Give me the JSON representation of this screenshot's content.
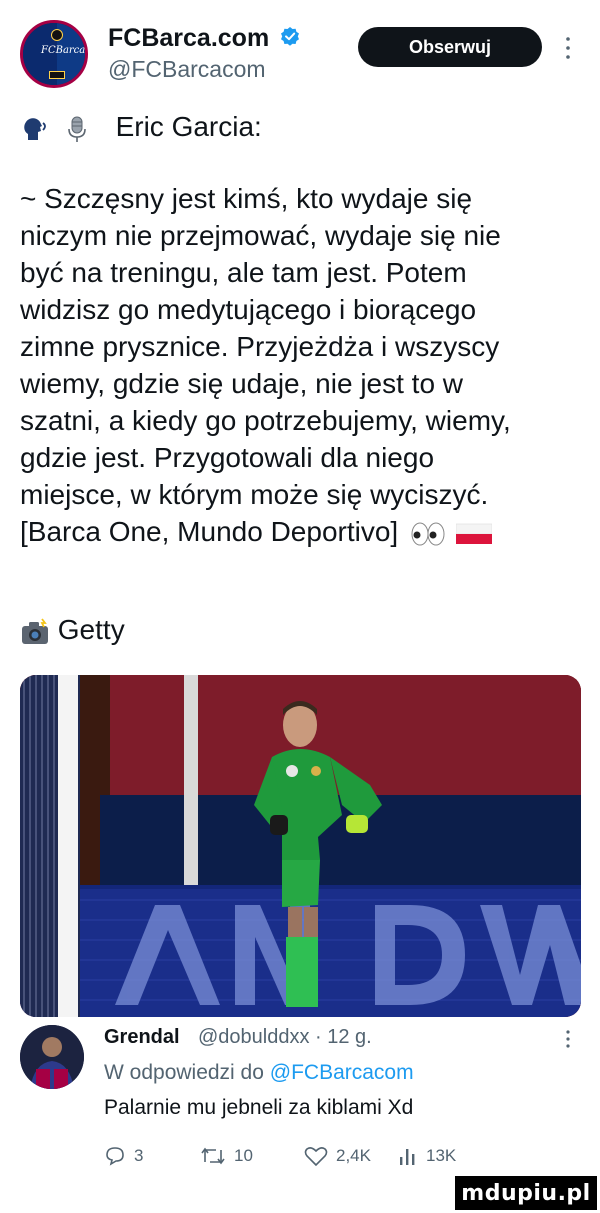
{
  "author": {
    "display_name": "FCBarca.com",
    "handle": "@FCBarcacom",
    "verified": true,
    "follow_label": "Obserwuj"
  },
  "tweet": {
    "speaker": "Eric Garcia:",
    "body_lines": [
      "~ Szczęsny jest kimś, kto wydaje się",
      "niczym nie przejmować, wydaje się nie",
      "być na treningu, ale tam jest. Potem",
      "widzisz go medytującego i biorącego",
      "zimne prysznice. Przyjeżdża i wszyscy",
      "wiemy, gdzie się udaje, nie jest to w",
      "szatni, a kiedy go potrzebujemy, wiemy,",
      "gdzie jest. Przygotowali dla niego",
      "miejsce, w którym może się wyciszyć.",
      "[Barca One, Mundo Deportivo]"
    ],
    "photo_credit": "Getty",
    "image_icons": [
      "speaking-head-icon",
      "microphone-icon",
      "eyes-icon",
      "poland-flag-icon",
      "camera-flash-icon"
    ]
  },
  "reply": {
    "display_name": "Grendal",
    "meta": "@dobulddxx · 12 g.",
    "reply_prefix": "W odpowiedzi do ",
    "reply_mention": "@FCBarcacom",
    "text": "Palarnie mu jebneli za kiblami Xd",
    "actions": {
      "replies": "3",
      "retweets": "10",
      "likes": "2,4K",
      "views": "13K"
    }
  },
  "watermark": "mdupiu.pl",
  "colors": {
    "accent": "#1d9bf0",
    "secondary_text": "#536471",
    "follow_bg": "#0f1419"
  }
}
